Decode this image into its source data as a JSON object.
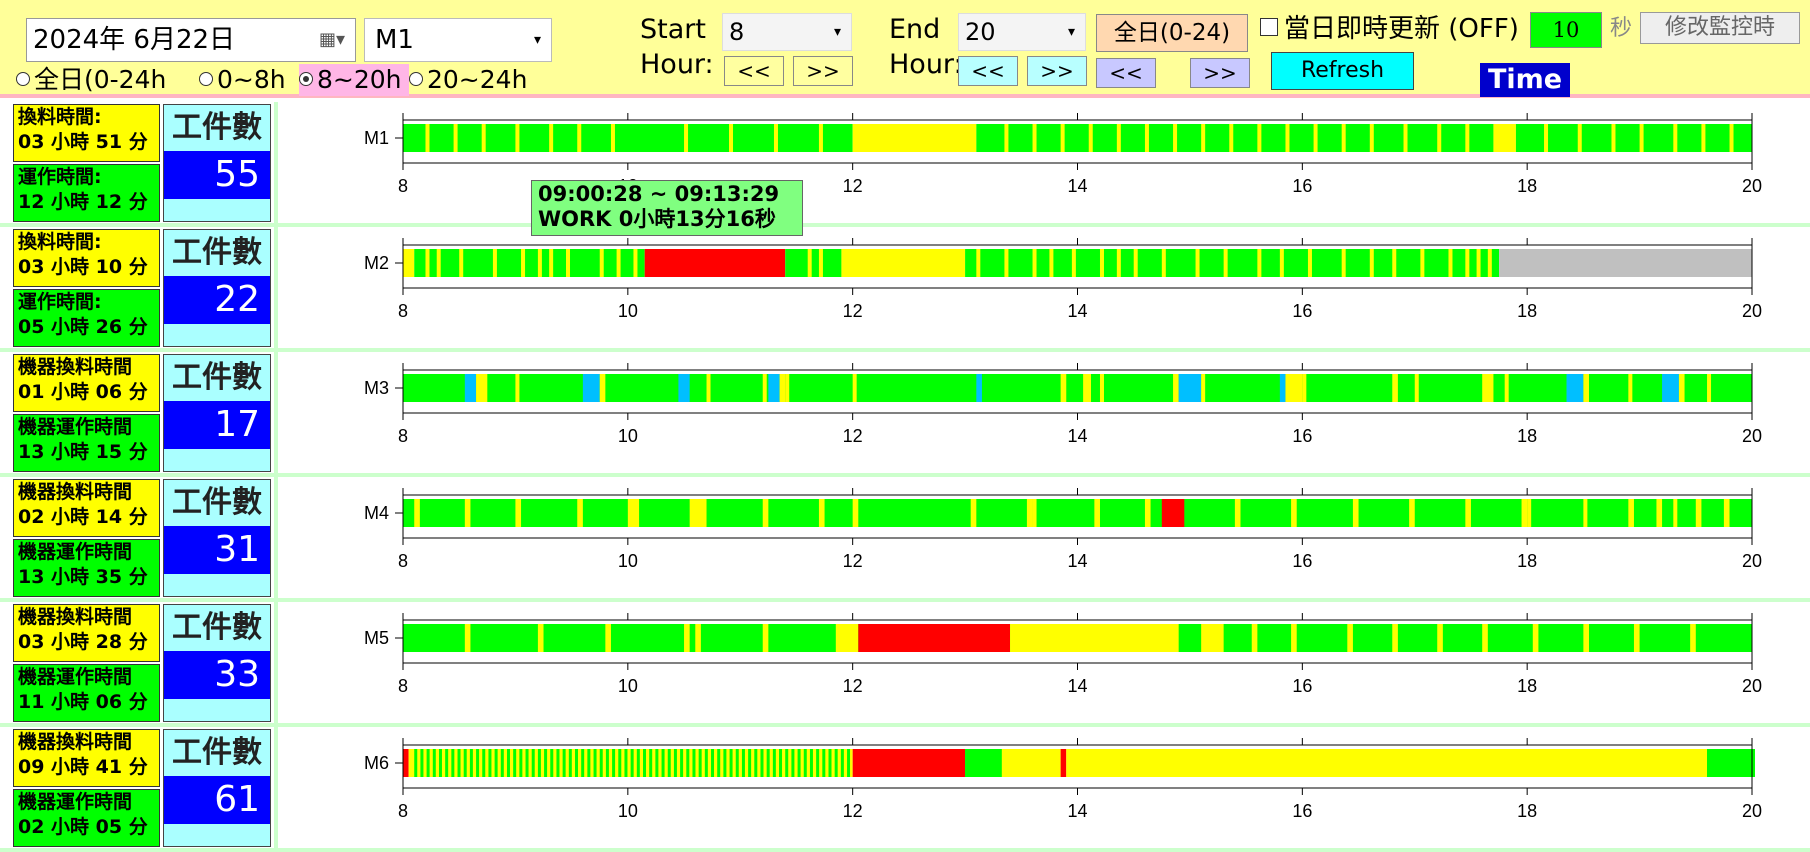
{
  "toolbar": {
    "date": "2024年  6月22日",
    "machine": "M1",
    "radios": [
      {
        "label": "全日(0-24h",
        "selected": false
      },
      {
        "label": "0~8h",
        "selected": false
      },
      {
        "label": "8~20h",
        "selected": true
      },
      {
        "label": "20~24h",
        "selected": false
      }
    ],
    "start_label_1": "Start",
    "start_label_2": "Hour:",
    "start_value": "8",
    "end_label_1": "End",
    "end_label_2": "Hour:",
    "end_value": "20",
    "prev": "<<",
    "next": ">>",
    "all_day_button": "全日(0-24)",
    "refresh_button": "Refresh",
    "auto_update_label": "當日即時更新 (OFF)",
    "interval_value": "10",
    "interval_unit": "秒",
    "modify_button": "修改監控時",
    "time_label": "Time"
  },
  "tooltip": {
    "line1": "09:00:28 ~ 09:13:29",
    "line2": "WORK 0小時13分16秒"
  },
  "colors": {
    "work": "#00ff00",
    "change": "#ffff00",
    "alarm": "#ff0000",
    "idle": "#c0c0c0",
    "other": "#00bfff"
  },
  "machines": [
    {
      "name": "M1",
      "change_label": "換料時間:",
      "change_value": "03 小時 51 分",
      "run_label": "運作時間:",
      "run_value": "12 小時 12 分",
      "count_title": "工件數",
      "count": "55",
      "ticks": [
        "8",
        "10",
        "12",
        "14",
        "16",
        "18",
        "20"
      ]
    },
    {
      "name": "M2",
      "change_label": "換料時間:",
      "change_value": "03 小時 10 分",
      "run_label": "運作時間:",
      "run_value": "05 小時 26 分",
      "count_title": "工件數",
      "count": "22",
      "ticks": [
        "8",
        "10",
        "12",
        "14",
        "16",
        "18",
        "20"
      ]
    },
    {
      "name": "M3",
      "change_label": "機器換料時間",
      "change_value": "01 小時 06 分",
      "run_label": "機器運作時間",
      "run_value": "13 小時 15 分",
      "count_title": "工件數",
      "count": "17",
      "ticks": [
        "8",
        "10",
        "12",
        "14",
        "16",
        "18",
        "20"
      ]
    },
    {
      "name": "M4",
      "change_label": "機器換料時間",
      "change_value": "02 小時 14 分",
      "run_label": "機器運作時間",
      "run_value": "13 小時 35 分",
      "count_title": "工件數",
      "count": "31",
      "ticks": [
        "8",
        "10",
        "12",
        "14",
        "16",
        "18",
        "20"
      ]
    },
    {
      "name": "M5",
      "change_label": "機器換料時間",
      "change_value": "03 小時 28 分",
      "run_label": "機器運作時間",
      "run_value": "11 小時 06 分",
      "count_title": "工件數",
      "count": "33",
      "ticks": [
        "8",
        "10",
        "12",
        "14",
        "16",
        "18",
        "20"
      ]
    },
    {
      "name": "M6",
      "change_label": "機器換料時間",
      "change_value": "09 小時 41 分",
      "run_label": "機器運作時間",
      "run_value": "02 小時 05 分",
      "count_title": "工件數",
      "count": "61",
      "ticks": [
        "8",
        "10",
        "12",
        "14",
        "16",
        "18",
        "20"
      ]
    }
  ],
  "chart_data": {
    "type": "timeline",
    "x_range": [
      8,
      20
    ],
    "x_ticks": [
      8,
      10,
      12,
      14,
      16,
      18,
      20
    ],
    "series": [
      {
        "name": "M1",
        "segments": [
          [
            8.0,
            12.0,
            "work"
          ],
          [
            12.0,
            13.1,
            "change"
          ],
          [
            13.1,
            17.7,
            "work"
          ],
          [
            17.7,
            17.9,
            "change"
          ],
          [
            17.9,
            20.0,
            "work"
          ]
        ],
        "breaks": [
          8.2,
          8.45,
          8.7,
          9.0,
          9.3,
          9.55,
          9.85,
          10.5,
          10.9,
          11.3,
          11.7,
          13.35,
          13.6,
          13.85,
          14.1,
          14.35,
          14.6,
          14.85,
          15.1,
          15.35,
          15.6,
          15.85,
          16.1,
          16.35,
          16.6,
          16.9,
          17.2,
          17.45,
          18.15,
          18.45,
          18.75,
          19.0,
          19.3,
          19.55,
          19.8
        ]
      },
      {
        "name": "M2",
        "segments": [
          [
            8.0,
            8.1,
            "change"
          ],
          [
            8.1,
            10.15,
            "work"
          ],
          [
            10.15,
            11.4,
            "alarm"
          ],
          [
            11.4,
            11.9,
            "work"
          ],
          [
            11.9,
            13.0,
            "change"
          ],
          [
            13.0,
            17.75,
            "work"
          ],
          [
            17.75,
            20.0,
            "idle"
          ]
        ],
        "breaks": [
          8.2,
          8.3,
          8.5,
          8.8,
          9.05,
          9.2,
          9.3,
          9.45,
          9.75,
          9.9,
          10.05,
          11.6,
          11.7,
          13.1,
          13.35,
          13.6,
          13.75,
          13.95,
          14.2,
          14.35,
          14.5,
          14.75,
          15.05,
          15.3,
          15.6,
          15.8,
          16.05,
          16.35,
          16.6,
          16.8,
          17.05,
          17.3,
          17.45,
          17.55,
          17.65
        ]
      },
      {
        "name": "M3",
        "segments": [
          [
            8.0,
            20.0,
            "work"
          ],
          [
            8.55,
            8.65,
            "other"
          ],
          [
            8.65,
            8.75,
            "change"
          ],
          [
            9.6,
            9.75,
            "other"
          ],
          [
            9.75,
            9.8,
            "change"
          ],
          [
            10.45,
            10.55,
            "other"
          ],
          [
            11.25,
            11.35,
            "other"
          ],
          [
            11.35,
            11.4,
            "change"
          ],
          [
            13.1,
            13.15,
            "other"
          ],
          [
            13.85,
            13.9,
            "change"
          ],
          [
            14.05,
            14.12,
            "change"
          ],
          [
            14.85,
            14.9,
            "change"
          ],
          [
            14.9,
            15.1,
            "other"
          ],
          [
            15.8,
            15.85,
            "other"
          ],
          [
            15.85,
            16.0,
            "change"
          ],
          [
            16.8,
            16.85,
            "change"
          ],
          [
            17.6,
            17.7,
            "change"
          ],
          [
            18.35,
            18.5,
            "other"
          ],
          [
            18.5,
            18.55,
            "change"
          ],
          [
            19.2,
            19.35,
            "other"
          ],
          [
            19.35,
            19.4,
            "change"
          ]
        ],
        "breaks": [
          8.7,
          9.0,
          10.7,
          11.2,
          11.4,
          12.0,
          14.2,
          15.1,
          16.0,
          17.0,
          17.8,
          18.9,
          19.6
        ]
      },
      {
        "name": "M4",
        "segments": [
          [
            8.0,
            20.0,
            "work"
          ],
          [
            8.1,
            8.15,
            "change"
          ],
          [
            8.55,
            8.6,
            "change"
          ],
          [
            9.0,
            9.05,
            "change"
          ],
          [
            9.55,
            9.6,
            "change"
          ],
          [
            10.0,
            10.1,
            "change"
          ],
          [
            10.55,
            10.7,
            "change"
          ],
          [
            11.2,
            11.25,
            "change"
          ],
          [
            11.7,
            11.75,
            "change"
          ],
          [
            12.0,
            12.05,
            "change"
          ],
          [
            13.05,
            13.1,
            "change"
          ],
          [
            13.55,
            13.6,
            "change"
          ],
          [
            14.15,
            14.2,
            "change"
          ],
          [
            14.6,
            14.65,
            "change"
          ],
          [
            14.75,
            14.95,
            "alarm"
          ],
          [
            15.4,
            15.45,
            "change"
          ],
          [
            15.9,
            15.95,
            "change"
          ],
          [
            16.45,
            16.5,
            "change"
          ],
          [
            16.95,
            17.0,
            "change"
          ],
          [
            17.45,
            17.5,
            "change"
          ],
          [
            17.95,
            18.0,
            "change"
          ],
          [
            18.9,
            18.95,
            "change"
          ],
          [
            19.15,
            19.2,
            "change"
          ],
          [
            19.5,
            19.55,
            "change"
          ],
          [
            19.75,
            19.8,
            "change"
          ]
        ],
        "breaks": [
          13.6,
          18.0,
          18.5,
          19.3
        ]
      },
      {
        "name": "M5",
        "segments": [
          [
            8.0,
            20.0,
            "work"
          ],
          [
            8.55,
            8.6,
            "change"
          ],
          [
            9.2,
            9.25,
            "change"
          ],
          [
            9.8,
            9.85,
            "change"
          ],
          [
            10.5,
            10.55,
            "change"
          ],
          [
            10.6,
            10.65,
            "change"
          ],
          [
            11.2,
            11.25,
            "change"
          ],
          [
            11.85,
            12.05,
            "change"
          ],
          [
            12.05,
            13.4,
            "alarm"
          ],
          [
            13.4,
            14.9,
            "change"
          ],
          [
            15.1,
            15.3,
            "change"
          ],
          [
            15.55,
            15.6,
            "change"
          ],
          [
            15.9,
            15.95,
            "change"
          ],
          [
            16.4,
            16.45,
            "change"
          ],
          [
            16.8,
            16.85,
            "change"
          ],
          [
            17.2,
            17.25,
            "change"
          ],
          [
            17.6,
            17.65,
            "change"
          ],
          [
            18.05,
            18.1,
            "change"
          ],
          [
            18.5,
            18.55,
            "change"
          ],
          [
            18.95,
            19.0,
            "change"
          ],
          [
            19.45,
            19.5,
            "change"
          ]
        ],
        "breaks": [
          13.7,
          13.8,
          13.9,
          14.05,
          14.15,
          14.3,
          14.45,
          14.6,
          14.75,
          14.85
        ]
      },
      {
        "name": "M6",
        "segments": [
          [
            8.0,
            8.05,
            "alarm"
          ],
          [
            8.05,
            12.0,
            "change"
          ],
          [
            12.0,
            13.0,
            "alarm"
          ],
          [
            13.0,
            13.3,
            "work"
          ],
          [
            13.3,
            13.85,
            "change"
          ],
          [
            13.85,
            13.9,
            "alarm"
          ],
          [
            13.9,
            19.6,
            "change"
          ],
          [
            19.6,
            20.0,
            "work"
          ]
        ],
        "work_ticks": [
          [
            8.1,
            12.0,
            0.055
          ],
          [
            13.0,
            13.3,
            0.02
          ],
          [
            19.6,
            20.0,
            0.04
          ]
        ]
      }
    ]
  }
}
